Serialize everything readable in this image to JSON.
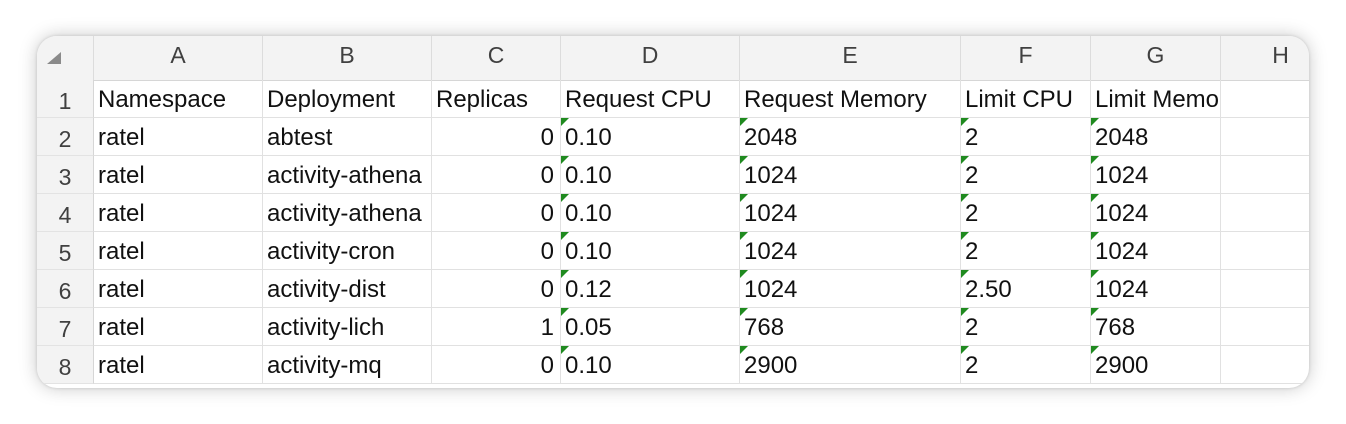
{
  "columns": [
    "A",
    "B",
    "C",
    "D",
    "E",
    "F",
    "G",
    "H"
  ],
  "rows": [
    {
      "num": "1",
      "cells": [
        "Namespace",
        "Deployment",
        "Replicas",
        "Request CPU",
        "Request Memory",
        "Limit CPU",
        "Limit Memory",
        ""
      ]
    },
    {
      "num": "2",
      "cells": [
        "ratel",
        "abtest",
        "0",
        "0.10",
        "2048",
        "2",
        "2048",
        ""
      ]
    },
    {
      "num": "3",
      "cells": [
        "ratel",
        "activity-athena",
        "0",
        "0.10",
        "1024",
        "2",
        "1024",
        ""
      ]
    },
    {
      "num": "4",
      "cells": [
        "ratel",
        "activity-athena",
        "0",
        "0.10",
        "1024",
        "2",
        "1024",
        ""
      ]
    },
    {
      "num": "5",
      "cells": [
        "ratel",
        "activity-cron",
        "0",
        "0.10",
        "1024",
        "2",
        "1024",
        ""
      ]
    },
    {
      "num": "6",
      "cells": [
        "ratel",
        "activity-dist",
        "0",
        "0.12",
        "1024",
        "2.50",
        "1024",
        ""
      ]
    },
    {
      "num": "7",
      "cells": [
        "ratel",
        "activity-lich",
        "1",
        "0.05",
        "768",
        "2",
        "768",
        ""
      ]
    },
    {
      "num": "8",
      "cells": [
        "ratel",
        "activity-mq",
        "0",
        "0.10",
        "2900",
        "2",
        "2900",
        ""
      ]
    }
  ],
  "colors": {
    "text_as_number_flag": "#1f8a1f",
    "header_bg": "#f3f3f3",
    "grid": "#e1e1e1"
  }
}
